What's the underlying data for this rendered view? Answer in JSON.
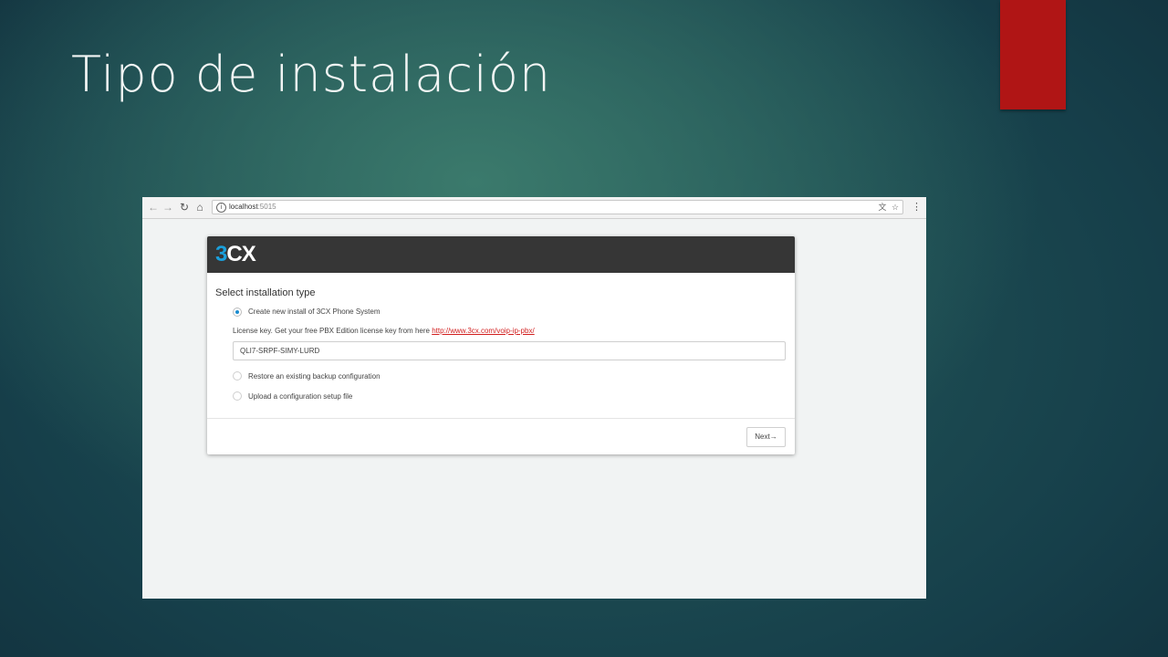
{
  "slide": {
    "title": "Tipo de instalación",
    "accent_color": "#b01515"
  },
  "browser": {
    "url_host": "localhost",
    "url_port": ":5015",
    "back_icon": "←",
    "forward_icon": "→",
    "reload_icon": "↻",
    "home_icon": "⌂",
    "info_icon": "i",
    "translate_icon": "文",
    "bookmark_icon": "☆",
    "menu_icon": "⋮"
  },
  "app": {
    "logo_three": "3",
    "logo_cx": "CX",
    "brand_color": "#1aa0dc",
    "section_title": "Select installation type",
    "options": [
      {
        "label": "Create new install of 3CX Phone System",
        "selected": true
      },
      {
        "label": "Restore an existing backup configuration",
        "selected": false
      },
      {
        "label": "Upload a configuration setup file",
        "selected": false
      }
    ],
    "license_text": "License key. Get your free PBX Edition license key from here ",
    "license_link": "http://www.3cx.com/voip-ip-pbx/",
    "license_key_value": "QLI7-SRPF-SIMY-LURD",
    "next_label": "Next→"
  }
}
